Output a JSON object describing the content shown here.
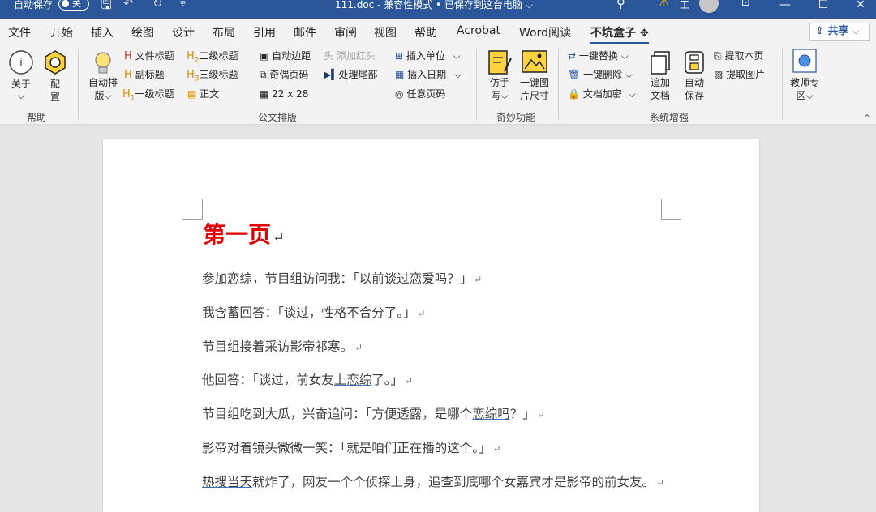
{
  "titlebar": {
    "autosave_label": "自动保存",
    "autosave_state": "关",
    "doc_title": "111.doc - 兼容性模式 • 已保存到这台电脑 ⌵",
    "user_initial": "工"
  },
  "tabs": [
    "文件",
    "开始",
    "插入",
    "绘图",
    "设计",
    "布局",
    "引用",
    "邮件",
    "审阅",
    "视图",
    "帮助",
    "Acrobat",
    "Word阅读",
    "不坑盒子"
  ],
  "share_label": "共享",
  "ribbon": {
    "help": {
      "about": "关于",
      "config": "配\n置",
      "label": "帮助"
    },
    "gongwen": {
      "auto_layout": "自动排\n版⌵",
      "doc_title": "文件标题",
      "sub_title": "副标题",
      "h1": "一级标题",
      "h2": "二级标题",
      "h3": "三级标题",
      "body": "正文",
      "auto_margin": "自动边距",
      "add_red_head": "添加红头",
      "odd_even": "奇偶页码",
      "process_tail": "处理尾部",
      "grid": "22 x 28",
      "insert_unit": "插入单位",
      "insert_date": "插入日期",
      "any_page": "任意页码",
      "label": "公文排版"
    },
    "magic": {
      "handwrite": "仿手\n写⌵",
      "img_size": "一键图\n片尺寸",
      "label": "奇妙功能"
    },
    "system": {
      "replace": "一键替换",
      "delete": "一键删除",
      "encrypt": "文档加密",
      "append": "追加\n文档",
      "autosave": "自动\n保存",
      "extract_page": "提取本页",
      "extract_img": "提取图片",
      "label": "系统增强"
    },
    "teacher": {
      "label": "教师专\n区⌵"
    }
  },
  "document": {
    "title": "第一页",
    "paragraphs": [
      [
        "参加恋综，节目组访问我：「以前谈过恋爱吗？」"
      ],
      [
        "我含蓄回答：「谈过，性格不合分了。」"
      ],
      [
        "节目组接着采访影帝祁寒。"
      ],
      [
        "他回答：「谈过，前女友",
        "上恋综",
        "了。」"
      ],
      [
        "节目组吃到大瓜，兴奋追问：「方便透露，是哪个",
        "恋综吗",
        "？」"
      ],
      [
        "影帝对着镜头微微一笑：「就是咱们正在播的这个。」"
      ],
      [
        "",
        "热搜当天",
        "就炸了，网友一个个侦探上身，追查到底哪个女嘉宾才是影帝的前女友。"
      ]
    ]
  }
}
